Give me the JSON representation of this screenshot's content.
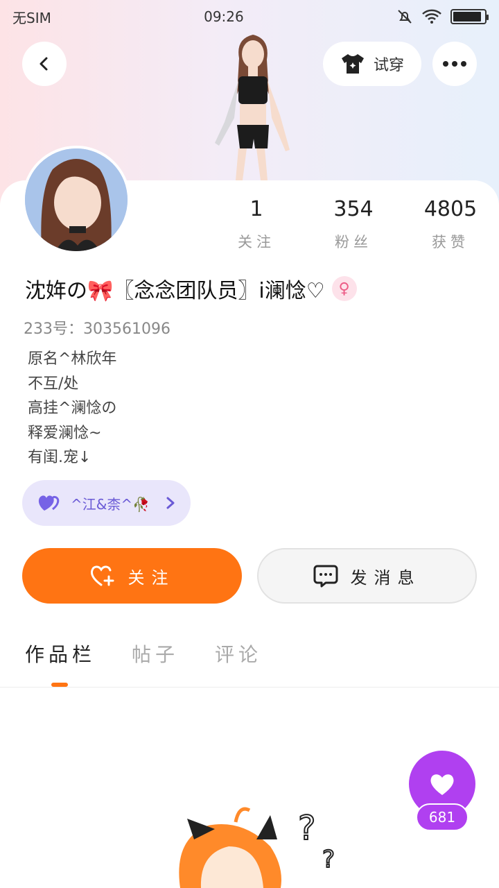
{
  "status_bar": {
    "carrier": "无SIM",
    "time": "09:26"
  },
  "header": {
    "tryon_label": "试穿"
  },
  "stats": [
    {
      "value": "1",
      "label": "关注"
    },
    {
      "value": "354",
      "label": "粉丝"
    },
    {
      "value": "4805",
      "label": "获赞"
    }
  ],
  "profile": {
    "nickname": "沈姩の🎀〖念念团队员〗i澜惗♡",
    "uid": "233号：303561096",
    "bio": [
      "原名^林欣年",
      "不互/处",
      "高挂^澜惗の",
      "释爱澜惗~",
      "有闺.宠↓"
    ],
    "fan_tag": "^江&柰^🥀"
  },
  "actions": {
    "follow": "关注",
    "message": "发消息"
  },
  "tabs": [
    "作品栏",
    "帖子",
    "评论"
  ],
  "like_count": "681",
  "colors": {
    "accent": "#ff7413",
    "like": "#b040f0",
    "tag_bg": "#e9e6fb"
  }
}
